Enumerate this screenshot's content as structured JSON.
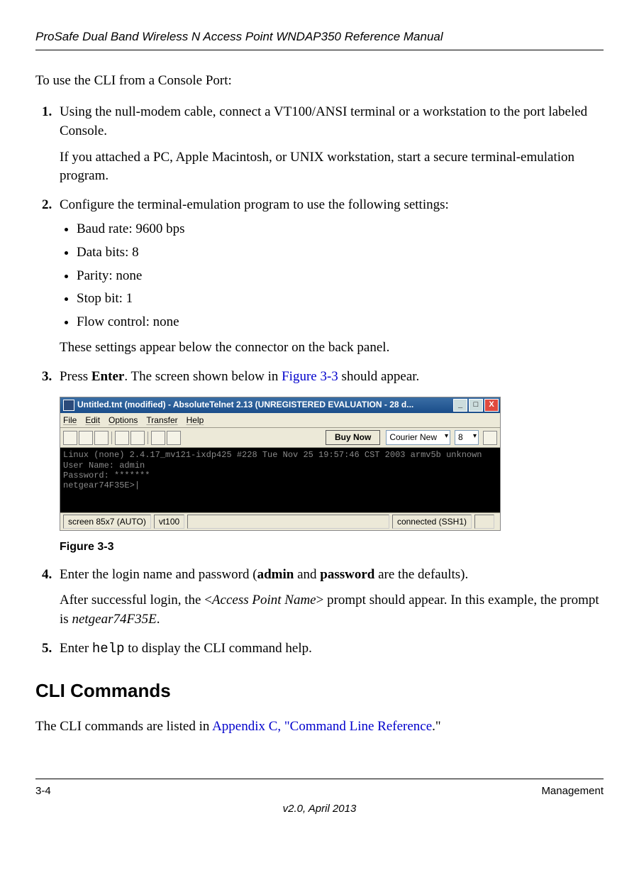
{
  "header": {
    "doc_title": "ProSafe Dual Band Wireless N Access Point WNDAP350 Reference Manual"
  },
  "intro": "To use the CLI from a Console Port:",
  "steps": {
    "s1": {
      "para1": "Using the null-modem cable, connect a VT100/ANSI terminal or a workstation to the port labeled Console.",
      "para2": "If you attached a PC, Apple Macintosh, or UNIX workstation, start a secure terminal-emulation program."
    },
    "s2": {
      "para": "Configure the terminal-emulation program to use the following settings:",
      "bullets": [
        "Baud rate: 9600 bps",
        "Data bits: 8",
        "Parity: none",
        "Stop bit: 1",
        "Flow control: none"
      ],
      "after": "These settings appear below the connector on the back panel."
    },
    "s3": {
      "pre": "Press ",
      "bold": "Enter",
      "mid": ". The screen shown below in ",
      "link": "Figure 3-3",
      "post": " should appear."
    },
    "s4": {
      "pre": "Enter the login name and password (",
      "b1": "admin",
      "mid1": " and ",
      "b2": "password",
      "post1": " are the defaults).",
      "para2a": "After successful login, the <",
      "para2b": "Access Point Name",
      "para2c": "> prompt should appear. In this example, the prompt is ",
      "para2d": "netgear74F35E",
      "para2e": "."
    },
    "s5": {
      "pre": "Enter ",
      "code": "help",
      "post": " to display the CLI command help."
    }
  },
  "figure": {
    "caption": "Figure 3-3",
    "titlebar": "Untitled.tnt (modified) - AbsoluteTelnet 2.13   (UNREGISTERED EVALUATION - 28 d...",
    "menus": [
      "File",
      "Edit",
      "Options",
      "Transfer",
      "Help"
    ],
    "buy": "Buy Now",
    "font": "Courier New",
    "fontsize": "8",
    "terminal_lines": [
      "Linux (none) 2.4.17_mv121-ixdp425 #228 Tue Nov 25 19:57:46 CST 2003 armv5b unknown",
      "User Name: admin",
      "Password: *******",
      "netgear74F35E>|"
    ],
    "status": {
      "left": "screen 85x7 (AUTO)",
      "mid": "vt100",
      "right": "connected (SSH1)"
    }
  },
  "section_title": "CLI Commands",
  "section_body": {
    "pre": "The CLI commands are listed in ",
    "link": "Appendix C, \"Command Line Reference",
    "post": ".\""
  },
  "footer": {
    "left": "3-4",
    "right": "Management",
    "center": "v2.0, April 2013"
  }
}
